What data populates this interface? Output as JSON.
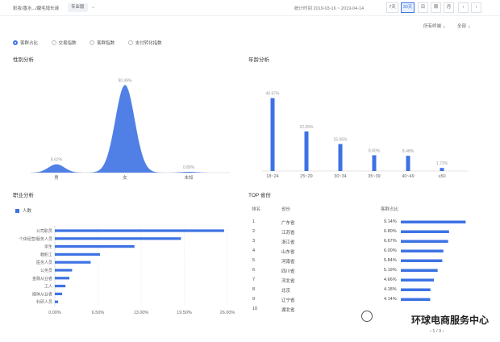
{
  "header": {
    "breadcrumb": "彩妆/香水.../睫毛增长液",
    "pro_badge": "专业版",
    "period_label": "统计时间 2019-03-16 ~ 2019-04-14",
    "ranges": [
      "7天",
      "30天",
      "日",
      "周",
      "月"
    ],
    "active_range": "30天",
    "nav_prev": "‹",
    "nav_next": "›"
  },
  "filters": {
    "channel": "所有终端 ⌄",
    "scope": "全部 ⌄"
  },
  "metrics": {
    "options": [
      "客群占比",
      "交易指数",
      "客群指数",
      "支付转化指数"
    ],
    "selected": "客群占比"
  },
  "gender": {
    "title": "性别分析",
    "chart_data": {
      "type": "area",
      "categories": [
        "男",
        "女",
        "未知"
      ],
      "values": [
        8.62,
        90.49,
        0.89
      ],
      "value_labels": [
        "8.62%",
        "90.49%",
        "0.89%"
      ]
    }
  },
  "age": {
    "title": "年龄分析",
    "chart_data": {
      "type": "bar",
      "categories": [
        "18~24",
        "25~29",
        "30~34",
        "35~39",
        "40~49",
        "≥50"
      ],
      "values": [
        40.67,
        22.05,
        15.06,
        8.8,
        8.48,
        1.72
      ],
      "value_labels": [
        "40.67%",
        "22.05%",
        "15.06%",
        "8.80%",
        "8.48%",
        "1.72%"
      ],
      "ylim": [
        0,
        45
      ]
    }
  },
  "occupation": {
    "title": "职业分析",
    "legend": "人数",
    "chart_data": {
      "type": "bar",
      "orientation": "horizontal",
      "categories": [
        "公司职员",
        "个体经营/服务人员",
        "学生",
        "教职工",
        "医务人员",
        "公务员",
        "金融从业者",
        "工人",
        "媒体从业者",
        "科研人员"
      ],
      "values": [
        25.5,
        19.0,
        12.0,
        6.8,
        5.4,
        2.6,
        2.2,
        1.6,
        1.1,
        0.5
      ],
      "xticks": [
        "0.00%",
        "6.50%",
        "13.00%",
        "19.50%",
        "26.00%"
      ],
      "xlim": [
        0,
        26
      ]
    }
  },
  "top_provinces": {
    "title": "TOP 省份",
    "columns": [
      "排名",
      "省份",
      "客群占比"
    ],
    "rows": [
      {
        "rank": "1",
        "name": "广东省",
        "pct": "9.14%",
        "value": 9.14
      },
      {
        "rank": "2",
        "name": "江苏省",
        "pct": "6.80%",
        "value": 6.8
      },
      {
        "rank": "3",
        "name": "浙江省",
        "pct": "6.67%",
        "value": 6.67
      },
      {
        "rank": "4",
        "name": "山东省",
        "pct": "6.00%",
        "value": 6.0
      },
      {
        "rank": "5",
        "name": "河南省",
        "pct": "5.84%",
        "value": 5.84
      },
      {
        "rank": "6",
        "name": "四川省",
        "pct": "5.19%",
        "value": 5.19
      },
      {
        "rank": "7",
        "name": "河北省",
        "pct": "4.66%",
        "value": 4.66
      },
      {
        "rank": "8",
        "name": "北京",
        "pct": "4.18%",
        "value": 4.18
      },
      {
        "rank": "9",
        "name": "辽宁省",
        "pct": "4.14%",
        "value": 4.14
      },
      {
        "rank": "10",
        "name": "湖北省",
        "pct": "",
        "value": 0
      }
    ],
    "pager": "‹ 1 / 3 ›"
  },
  "watermark": "环球电商服务中心",
  "colors": {
    "accent": "#3d72e3",
    "grid": "#e6e9ef"
  }
}
